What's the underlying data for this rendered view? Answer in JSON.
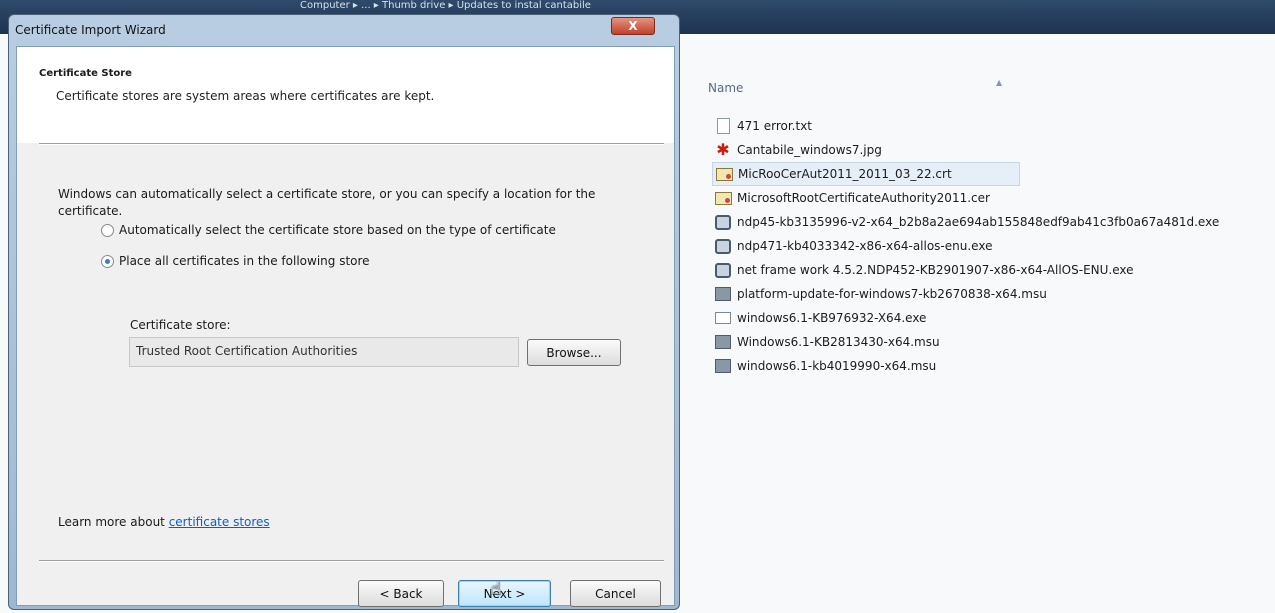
{
  "explorer": {
    "breadcrumb": "Computer ▸ ... ▸ Thumb drive ▸ Updates to instal cantabile",
    "column_name": "Name",
    "files": [
      {
        "name": "471 error.txt",
        "icon": "text-file-icon"
      },
      {
        "name": "Cantabile_windows7.jpg",
        "icon": "jpg-file-icon"
      },
      {
        "name": "MicRooCerAut2011_2011_03_22.crt",
        "icon": "certificate-file-icon",
        "selected": true
      },
      {
        "name": "MicrosoftRootCertificateAuthority2011.cer",
        "icon": "certificate-file-icon"
      },
      {
        "name": "ndp45-kb3135996-v2-x64_b2b8a2ae694ab155848edf9ab41c3fb0a67a481d.exe",
        "icon": "installer-exe-icon"
      },
      {
        "name": "ndp471-kb4033342-x86-x64-allos-enu.exe",
        "icon": "installer-exe-icon"
      },
      {
        "name": "net frame work 4.5.2.NDP452-KB2901907-x86-x64-AllOS-ENU.exe",
        "icon": "installer-exe-icon"
      },
      {
        "name": "platform-update-for-windows7-kb2670838-x64.msu",
        "icon": "msu-file-icon"
      },
      {
        "name": "windows6.1-KB976932-X64.exe",
        "icon": "window-exe-icon"
      },
      {
        "name": "Windows6.1-KB2813430-x64.msu",
        "icon": "msu-file-icon"
      },
      {
        "name": "windows6.1-kb4019990-x64.msu",
        "icon": "msu-file-icon"
      }
    ]
  },
  "dialog": {
    "title": "Certificate Import Wizard",
    "close_label": "X",
    "section_title": "Certificate Store",
    "section_desc": "Certificate stores are system areas where certificates are kept.",
    "intro": "Windows can automatically select a certificate store, or you can specify a location for the certificate.",
    "radio_auto": "Automatically select the certificate store based on the type of certificate",
    "radio_place": "Place all certificates in the following store",
    "selected_option": "radio_place",
    "store_label": "Certificate store:",
    "store_value": "Trusted Root Certification Authorities",
    "browse_label": "Browse...",
    "learn_prefix": "Learn more about ",
    "learn_link": "certificate stores",
    "back_label": "< Back",
    "next_label": "Next >",
    "cancel_label": "Cancel"
  }
}
